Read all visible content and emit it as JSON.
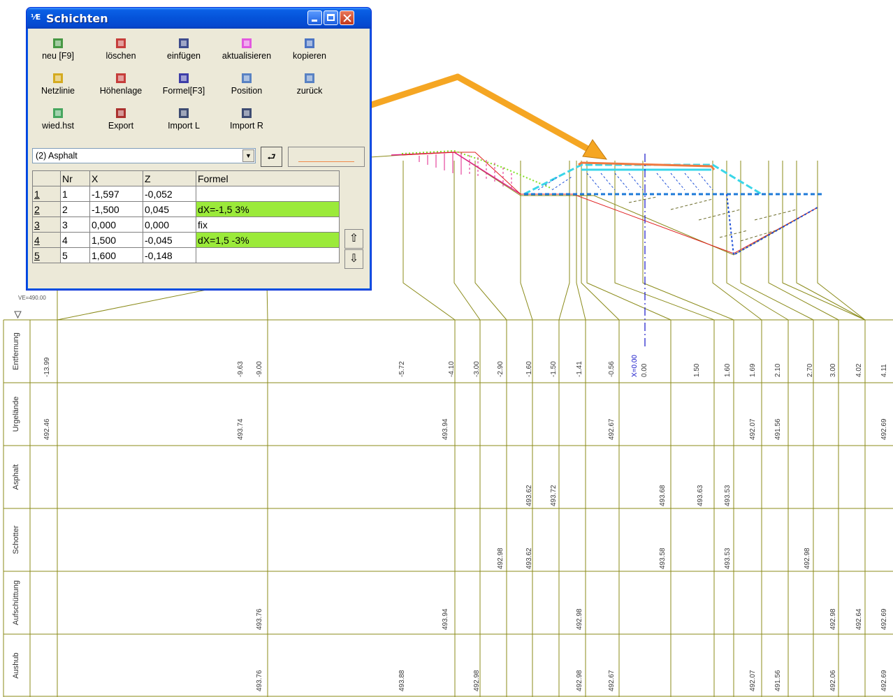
{
  "window": {
    "title": "Schichten",
    "app_icon_text": "⅟E",
    "toolbar": [
      {
        "label": "neu [F9]",
        "icon": "new-layer-icon"
      },
      {
        "label": "löschen",
        "icon": "delete-layer-icon"
      },
      {
        "label": "einfügen",
        "icon": "insert-layer-icon"
      },
      {
        "label": "aktualisieren",
        "icon": "refresh-icon"
      },
      {
        "label": "kopieren",
        "icon": "copy-icon"
      },
      {
        "label": "Netzlinie",
        "icon": "netline-icon"
      },
      {
        "label": "Höhenlage",
        "icon": "elevation-icon"
      },
      {
        "label": "Formel[F3]",
        "icon": "formula-icon"
      },
      {
        "label": "Position",
        "icon": "position-icon"
      },
      {
        "label": "zurück",
        "icon": "back-icon"
      },
      {
        "label": "wied.hst",
        "icon": "restore-icon"
      },
      {
        "label": "Export",
        "icon": "export-icon"
      },
      {
        "label": "Import L",
        "icon": "import-left-icon"
      },
      {
        "label": "Import R",
        "icon": "import-right-icon"
      }
    ],
    "layer_select": "(2) Asphalt",
    "table": {
      "headers": [
        "Nr",
        "X",
        "Z",
        "Formel"
      ],
      "rows": [
        {
          "row": "1",
          "nr": "1",
          "x": "-1,597",
          "z": "-0,052",
          "formel": ""
        },
        {
          "row": "2",
          "nr": "2",
          "x": "-1,500",
          "z": "0,045",
          "formel": "dX=-1,5 3%"
        },
        {
          "row": "3",
          "nr": "3",
          "x": "0,000",
          "z": "0,000",
          "formel": "fix"
        },
        {
          "row": "4",
          "nr": "4",
          "x": "1,500",
          "z": "-0,045",
          "formel": "dX=1,5 -3%"
        },
        {
          "row": "5",
          "nr": "5",
          "x": "1,600",
          "z": "-0,148",
          "formel": ""
        }
      ]
    },
    "colors": {
      "highlight": "#9bea3a",
      "layer_line": "#f08a4a"
    }
  },
  "profile": {
    "ve_label": "VE=490.00",
    "axis_label": "X=0.00",
    "bands": [
      "Entfernung",
      "Urgelände",
      "Asphalt",
      "Schotter",
      "Aufschüttung",
      "Aushub"
    ],
    "entfernung": [
      "-13.99",
      "-9.63",
      "-9.00",
      "-5.72",
      "-4.10",
      "-3.00",
      "-2.90",
      "-1.60",
      "-1.50",
      "-1.41",
      "-0.56",
      "0.00",
      "1.50",
      "1.60",
      "1.69",
      "2.10",
      "2.70",
      "3.00",
      "4.02",
      "4.11"
    ],
    "urgelaende": [
      "492.46",
      "493.74",
      "493.94",
      "492.67",
      "492.07",
      "491.56",
      "492.69"
    ],
    "asphalt": [
      "493.62",
      "493.72",
      "493.68",
      "493.63",
      "493.53"
    ],
    "schotter": [
      "492.98",
      "493.62",
      "493.58",
      "493.53",
      "492.98"
    ],
    "aufschuettung": [
      "493.76",
      "493.94",
      "492.98",
      "492.98",
      "492.64",
      "492.69"
    ],
    "aushub": [
      "493.76",
      "493.88",
      "492.98",
      "492.98",
      "492.67",
      "492.07",
      "491.56",
      "492.06",
      "492.69"
    ],
    "colors": {
      "grid": "#8b8b1a",
      "centerline": "#1414c8",
      "arrow": "#f5a623"
    }
  }
}
